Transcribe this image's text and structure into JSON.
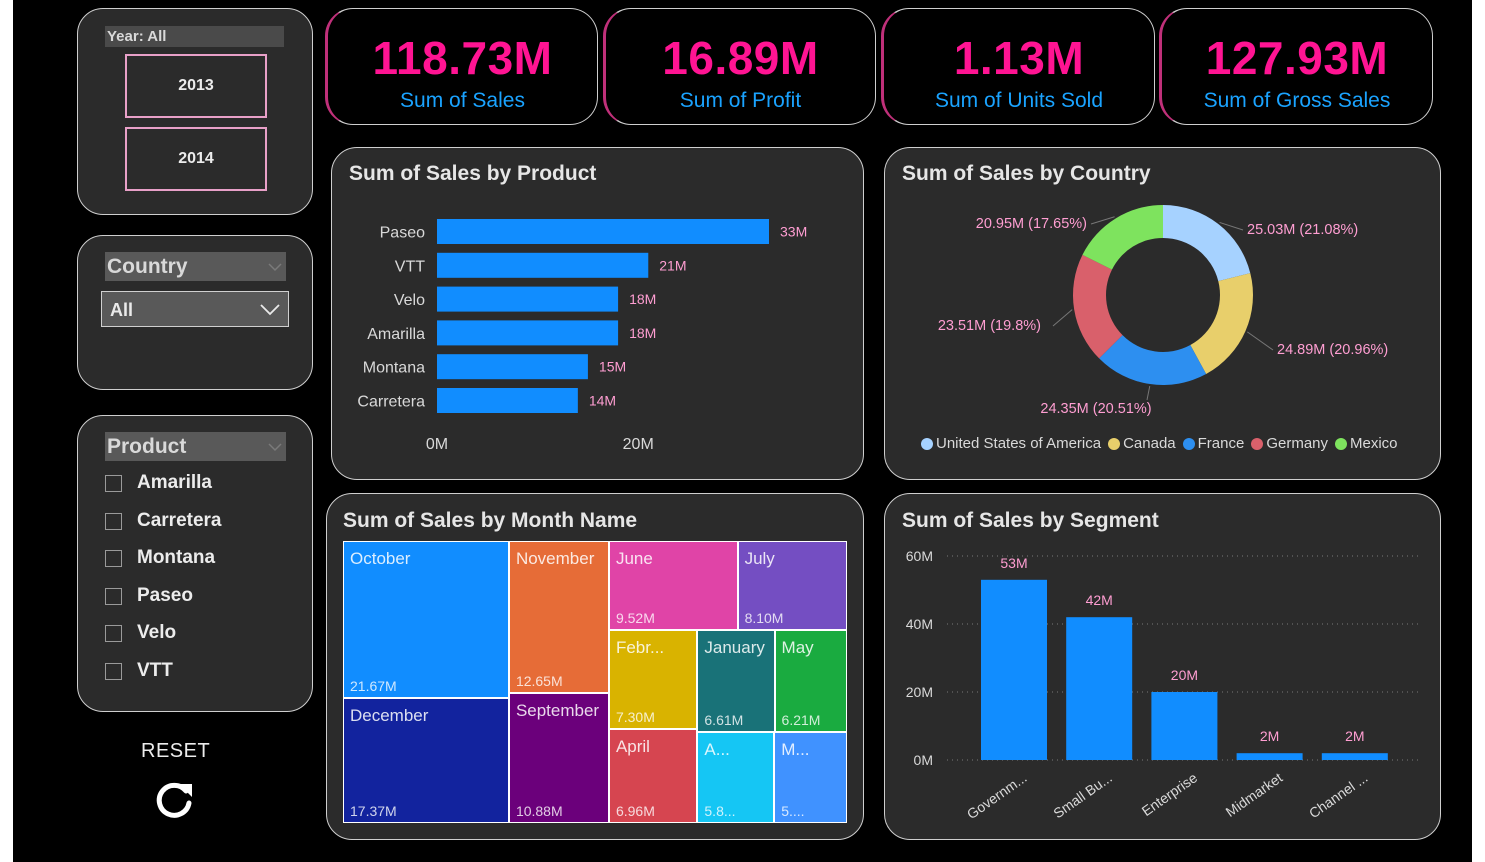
{
  "colors": {
    "accent": "#ff1493",
    "kpi_label": "#1aa3ff",
    "bar": "#118dff",
    "panel": "#2b2b2b"
  },
  "kpis": [
    {
      "value": "118.73M",
      "label": "Sum of Sales"
    },
    {
      "value": "16.89M",
      "label": "Sum of Profit"
    },
    {
      "value": "1.13M",
      "label": "Sum of Units Sold"
    },
    {
      "value": "127.93M",
      "label": "Sum of Gross Sales"
    }
  ],
  "year_slicer": {
    "header": "Year: All",
    "options": [
      "2013",
      "2014"
    ]
  },
  "country_slicer": {
    "header": "Country",
    "selected": "All"
  },
  "product_slicer": {
    "header": "Product",
    "items": [
      "Amarilla",
      "Carretera",
      "Montana",
      "Paseo",
      "Velo",
      "VTT"
    ]
  },
  "reset": {
    "label": "RESET",
    "icon": "refresh-icon"
  },
  "product_chart": {
    "title": "Sum of Sales by Product"
  },
  "country_chart": {
    "title": "Sum of Sales by Country"
  },
  "month_chart": {
    "title": "Sum of Sales by Month Name"
  },
  "segment_chart": {
    "title": "Sum of Sales by Segment"
  },
  "chart_data": [
    {
      "type": "bar",
      "orientation": "horizontal",
      "title": "Sum of Sales by Product",
      "categories": [
        "Paseo",
        "VTT",
        "Velo",
        "Amarilla",
        "Montana",
        "Carretera"
      ],
      "values": [
        33,
        21,
        18,
        18,
        15,
        14
      ],
      "data_labels": [
        "33M",
        "21M",
        "18M",
        "18M",
        "15M",
        "14M"
      ],
      "x_ticks": [
        "0M",
        "20M"
      ],
      "xlim": [
        0,
        33
      ],
      "grid": false
    },
    {
      "type": "pie",
      "donut": true,
      "title": "Sum of Sales by Country",
      "categories": [
        "United States of America",
        "Canada",
        "France",
        "Germany",
        "Mexico"
      ],
      "values": [
        25.03,
        24.89,
        24.35,
        23.51,
        20.95
      ],
      "data_labels": [
        "25.03M (21.08%)",
        "24.89M (20.96%)",
        "24.35M (20.51%)",
        "23.51M (19.8%)",
        "20.95M (17.65%)"
      ],
      "colors": [
        "#a6d2ff",
        "#e8cf6b",
        "#2d8ff0",
        "#d9606b",
        "#7ee35e"
      ],
      "legend": "bottom"
    },
    {
      "type": "treemap",
      "title": "Sum of Sales by Month Name",
      "items": [
        {
          "name": "October",
          "label": "21.67M",
          "value": 21.67,
          "color": "#118dff"
        },
        {
          "name": "December",
          "label": "17.37M",
          "value": 17.37,
          "color": "#12239e"
        },
        {
          "name": "November",
          "label": "12.65M",
          "value": 12.65,
          "color": "#e66c37"
        },
        {
          "name": "September",
          "label": "10.88M",
          "value": 10.88,
          "color": "#6b007b"
        },
        {
          "name": "June",
          "label": "9.52M",
          "value": 9.52,
          "color": "#e044a7"
        },
        {
          "name": "July",
          "label": "8.10M",
          "value": 8.1,
          "color": "#744ec2"
        },
        {
          "name": "Febr...",
          "label": "7.30M",
          "value": 7.3,
          "color": "#d9b300"
        },
        {
          "name": "April",
          "label": "6.96M",
          "value": 6.96,
          "color": "#d64550"
        },
        {
          "name": "January",
          "label": "6.61M",
          "value": 6.61,
          "color": "#197278"
        },
        {
          "name": "May",
          "label": "6.21M",
          "value": 6.21,
          "color": "#1aab40"
        },
        {
          "name": "A...",
          "label": "5.8...",
          "value": 5.8,
          "color": "#15c6f4"
        },
        {
          "name": "M...",
          "label": "5....",
          "value": 5.5,
          "color": "#4092ff"
        }
      ]
    },
    {
      "type": "bar",
      "orientation": "vertical",
      "title": "Sum of Sales by Segment",
      "categories": [
        "Governm...",
        "Small Bu...",
        "Enterprise",
        "Midmarket",
        "Channel ..."
      ],
      "values": [
        53,
        42,
        20,
        2,
        2
      ],
      "data_labels": [
        "53M",
        "42M",
        "20M",
        "2M",
        "2M"
      ],
      "y_ticks": [
        "0M",
        "20M",
        "40M",
        "60M"
      ],
      "ylim": [
        0,
        60
      ],
      "grid": true
    }
  ]
}
